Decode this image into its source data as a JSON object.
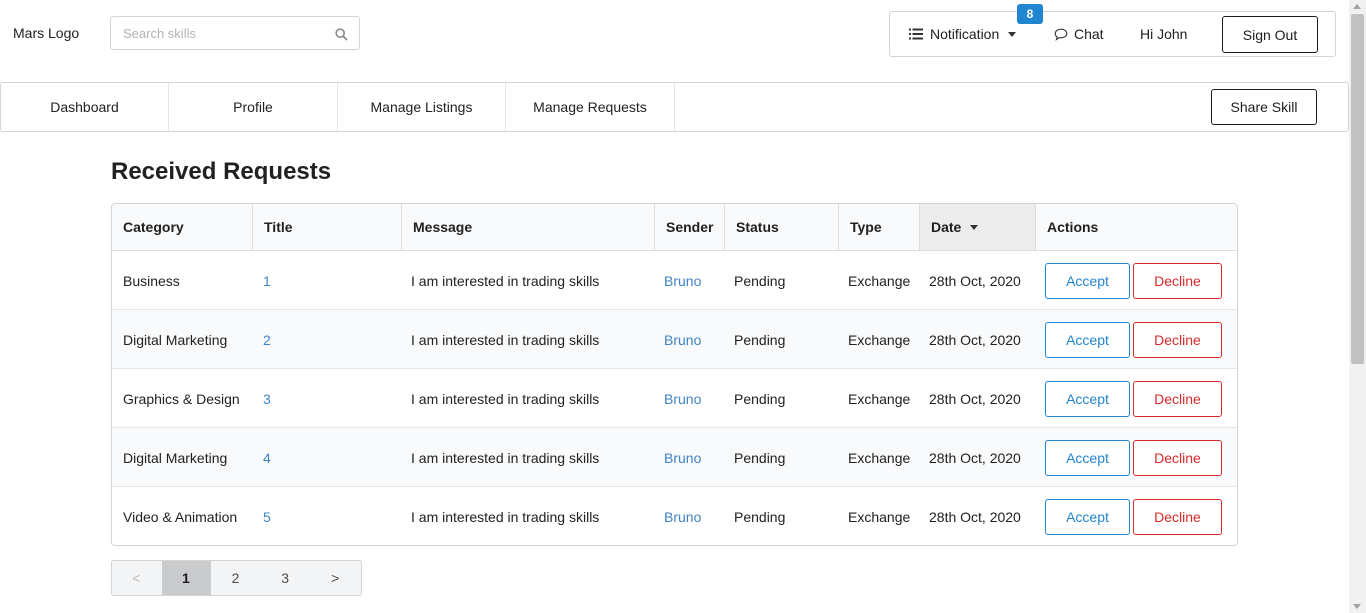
{
  "header": {
    "logo": "Mars Logo",
    "search_placeholder": "Search skills",
    "notification_label": "Notification",
    "notification_count": "8",
    "chat_label": "Chat",
    "greeting": "Hi John",
    "sign_out": "Sign Out"
  },
  "nav": {
    "items": [
      "Dashboard",
      "Profile",
      "Manage Listings",
      "Manage Requests"
    ],
    "share_skill": "Share Skill"
  },
  "page_title": "Received Requests",
  "table": {
    "headers": [
      "Category",
      "Title",
      "Message",
      "Sender",
      "Status",
      "Type",
      "Date",
      "Actions"
    ],
    "sorted_column": "Date",
    "rows": [
      {
        "category": "Business",
        "title": "1",
        "message": "I am interested in trading skills",
        "sender": "Bruno",
        "status": "Pending",
        "type": "Exchange",
        "date": "28th Oct, 2020"
      },
      {
        "category": "Digital Marketing",
        "title": "2",
        "message": "I am interested in trading skills",
        "sender": "Bruno",
        "status": "Pending",
        "type": "Exchange",
        "date": "28th Oct, 2020"
      },
      {
        "category": "Graphics & Design",
        "title": "3",
        "message": "I am interested in trading skills",
        "sender": "Bruno",
        "status": "Pending",
        "type": "Exchange",
        "date": "28th Oct, 2020"
      },
      {
        "category": "Digital Marketing",
        "title": "4",
        "message": "I am interested in trading skills",
        "sender": "Bruno",
        "status": "Pending",
        "type": "Exchange",
        "date": "28th Oct, 2020"
      },
      {
        "category": "Video & Animation",
        "title": "5",
        "message": "I am interested in trading skills",
        "sender": "Bruno",
        "status": "Pending",
        "type": "Exchange",
        "date": "28th Oct, 2020"
      }
    ],
    "accept_label": "Accept",
    "decline_label": "Decline"
  },
  "pagination": {
    "prev": "<",
    "pages": [
      "1",
      "2",
      "3"
    ],
    "current": "1",
    "next": ">"
  },
  "colors": {
    "accent_blue": "#2185d0",
    "link_blue": "#4183c4",
    "decline_red": "#db2828"
  },
  "icons": {
    "search": "search-icon",
    "notification": "list-icon",
    "chat": "chat-bubble-icon"
  }
}
